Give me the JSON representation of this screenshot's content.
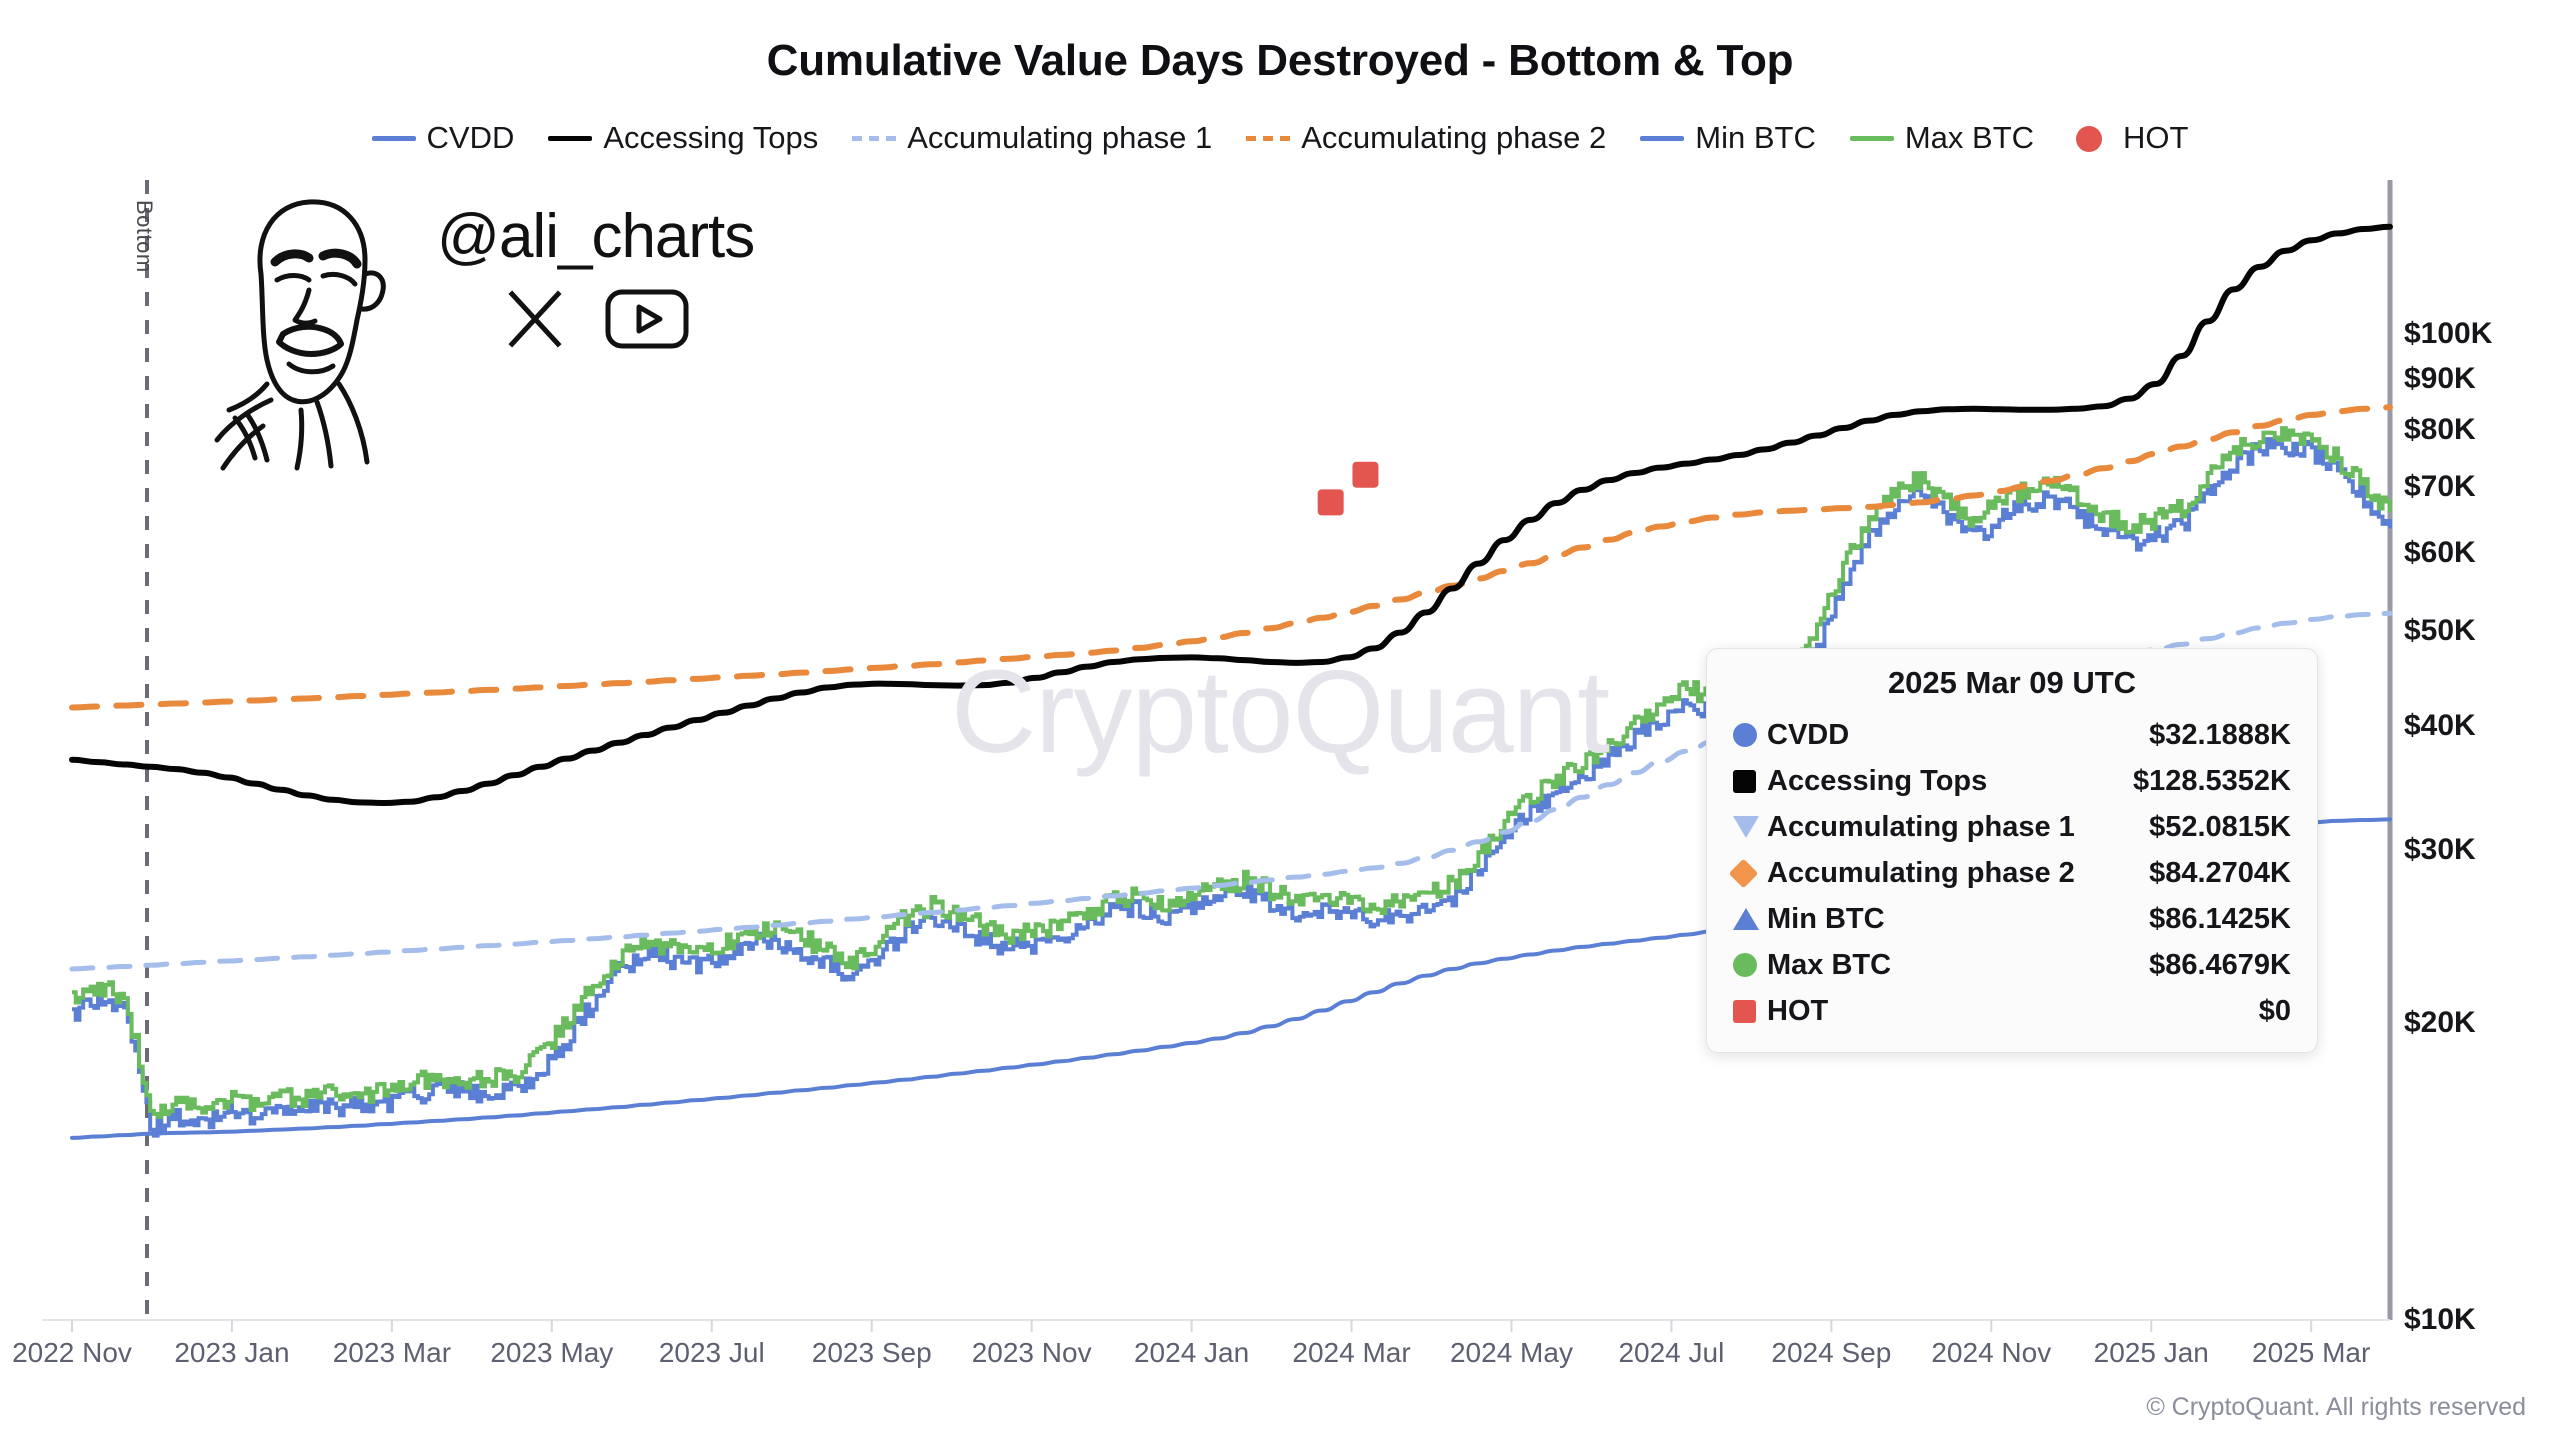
{
  "title": "Cumulative Value Days Destroyed - Bottom & Top",
  "footer": "© CryptoQuant. All rights reserved",
  "watermark_center": "CryptoQuant",
  "branding": {
    "handle": "@ali_charts",
    "x_icon": "x-logo-icon",
    "youtube_icon": "youtube-icon",
    "face_icon": "line-art-face-icon"
  },
  "annotations": [
    {
      "label": "Bottom",
      "x_value": "2022 Dec"
    }
  ],
  "legend": [
    {
      "label": "CVDD",
      "color": "#5b7fd4",
      "style": "line"
    },
    {
      "label": "Accessing Tops",
      "color": "#050505",
      "style": "line"
    },
    {
      "label": "Accumulating phase 1",
      "color": "#a5bdea",
      "style": "dashed"
    },
    {
      "label": "Accumulating phase 2",
      "color": "#e8893c",
      "style": "dashed"
    },
    {
      "label": "Min BTC",
      "color": "#5b7fd4",
      "style": "line"
    },
    {
      "label": "Max BTC",
      "color": "#6aba5e",
      "style": "line"
    },
    {
      "label": "HOT",
      "color": "#e2564f",
      "style": "dot"
    }
  ],
  "tooltip": {
    "title": "2025 Mar 09 UTC",
    "rows": [
      {
        "marker": "circle",
        "color": "#5b7fd4",
        "name": "CVDD",
        "value": "$32.1888K"
      },
      {
        "marker": "square",
        "color": "#050505",
        "name": "Accessing Tops",
        "value": "$128.5352K"
      },
      {
        "marker": "tri-down",
        "color": "#a5bdea",
        "name": "Accumulating phase 1",
        "value": "$52.0815K"
      },
      {
        "marker": "diamond",
        "color": "#f0954b",
        "name": "Accumulating phase 2",
        "value": "$84.2704K"
      },
      {
        "marker": "tri-up",
        "color": "#5b7fd4",
        "name": "Min BTC",
        "value": "$86.1425K"
      },
      {
        "marker": "circle",
        "color": "#6aba5e",
        "name": "Max BTC",
        "value": "$86.4679K"
      },
      {
        "marker": "square",
        "color": "#e2564f",
        "name": "HOT",
        "value": "$0"
      }
    ]
  },
  "chart_data": {
    "type": "line",
    "title": "Cumulative Value Days Destroyed - Bottom & Top",
    "xlabel": "",
    "ylabel": "",
    "yscale": "log",
    "ylim": [
      10000,
      140000
    ],
    "grid": false,
    "legend_position": "top",
    "y_ticks": [
      {
        "label": "$10K",
        "value": 10000
      },
      {
        "label": "$20K",
        "value": 20000
      },
      {
        "label": "$30K",
        "value": 30000
      },
      {
        "label": "$40K",
        "value": 40000
      },
      {
        "label": "$50K",
        "value": 50000
      },
      {
        "label": "$60K",
        "value": 60000
      },
      {
        "label": "$70K",
        "value": 70000
      },
      {
        "label": "$80K",
        "value": 80000
      },
      {
        "label": "$90K",
        "value": 90000
      },
      {
        "label": "$100K",
        "value": 100000
      }
    ],
    "x_ticks": [
      {
        "label": "2022 Nov",
        "t": 0.0
      },
      {
        "label": "2023 Jan",
        "t": 0.069
      },
      {
        "label": "2023 Mar",
        "t": 0.138
      },
      {
        "label": "2023 May",
        "t": 0.207
      },
      {
        "label": "2023 Jul",
        "t": 0.276
      },
      {
        "label": "2023 Sep",
        "t": 0.345
      },
      {
        "label": "2023 Nov",
        "t": 0.414
      },
      {
        "label": "2024 Jan",
        "t": 0.483
      },
      {
        "label": "2024 Mar",
        "t": 0.552
      },
      {
        "label": "2024 May",
        "t": 0.621
      },
      {
        "label": "2024 Jul",
        "t": 0.69
      },
      {
        "label": "2024 Sep",
        "t": 0.759
      },
      {
        "label": "2024 Nov",
        "t": 0.828
      },
      {
        "label": "2025 Jan",
        "t": 0.897
      },
      {
        "label": "2025 Mar",
        "t": 0.966
      }
    ],
    "series": [
      {
        "name": "CVDD",
        "color": "#5b7fd4",
        "style": "line",
        "width": 4,
        "values": [
          15300,
          15350,
          15400,
          15450,
          15480,
          15500,
          15520,
          15560,
          15600,
          15640,
          15690,
          15740,
          15800,
          15860,
          15920,
          15980,
          16050,
          16120,
          16200,
          16280,
          16360,
          16440,
          16530,
          16620,
          16710,
          16800,
          16900,
          17000,
          17100,
          17200,
          17310,
          17420,
          17530,
          17650,
          17780,
          17900,
          18030,
          18160,
          18300,
          18450,
          18600,
          18760,
          18930,
          19100,
          19300,
          19550,
          19850,
          20200,
          20600,
          21050,
          21500,
          21950,
          22350,
          22700,
          23000,
          23250,
          23480,
          23700,
          23900,
          24080,
          24250,
          24420,
          24600,
          24800,
          25050,
          25350,
          25700,
          26100,
          26550,
          27000,
          27450,
          27850,
          28200,
          28500,
          28780,
          29050,
          29330,
          29620,
          29920,
          30230,
          30540,
          30850,
          31150,
          31420,
          31650,
          31830,
          31970,
          32080,
          32150,
          32190
        ]
      },
      {
        "name": "Accessing Tops",
        "color": "#050505",
        "style": "line",
        "width": 6,
        "values": [
          37000,
          36800,
          36600,
          36400,
          36200,
          35900,
          35500,
          35000,
          34500,
          34050,
          33700,
          33500,
          33450,
          33550,
          33900,
          34400,
          35000,
          35700,
          36400,
          37100,
          37800,
          38500,
          39200,
          39900,
          40600,
          41300,
          42000,
          42700,
          43300,
          43800,
          44100,
          44200,
          44150,
          44050,
          44000,
          44050,
          44300,
          44800,
          45400,
          46000,
          46500,
          46800,
          46950,
          47000,
          46900,
          46700,
          46500,
          46400,
          46500,
          47000,
          48000,
          49800,
          52200,
          55200,
          58500,
          61800,
          64800,
          67400,
          69500,
          71100,
          72300,
          73200,
          73900,
          74600,
          75400,
          76400,
          77600,
          78900,
          80300,
          81700,
          82800,
          83500,
          83900,
          84000,
          83900,
          83800,
          83800,
          84000,
          84500,
          86000,
          89000,
          95000,
          103000,
          111000,
          117000,
          121500,
          124500,
          126500,
          127800,
          128500
        ]
      },
      {
        "name": "Accumulating phase 1",
        "color": "#a5bdea",
        "style": "dashed",
        "width": 5,
        "values": [
          22700,
          22760,
          22830,
          22900,
          22980,
          23050,
          23130,
          23200,
          23280,
          23360,
          23440,
          23520,
          23610,
          23700,
          23790,
          23880,
          23970,
          24060,
          24160,
          24260,
          24360,
          24460,
          24570,
          24680,
          24790,
          24900,
          25020,
          25140,
          25260,
          25380,
          25510,
          25640,
          25770,
          25900,
          26040,
          26180,
          26320,
          26470,
          26620,
          26770,
          26930,
          27090,
          27250,
          27420,
          27590,
          27770,
          27950,
          28130,
          28320,
          28520,
          28750,
          29050,
          29450,
          29950,
          30550,
          31250,
          32050,
          32950,
          33900,
          34900,
          35900,
          36850,
          37750,
          38600,
          39400,
          40150,
          40850,
          41500,
          42100,
          42650,
          43150,
          43600,
          44050,
          44500,
          44950,
          45400,
          45850,
          46300,
          46800,
          47300,
          47850,
          48450,
          49100,
          49750,
          50350,
          50900,
          51350,
          51700,
          51950,
          52080
        ]
      },
      {
        "name": "Accumulating phase 2",
        "color": "#e8893c",
        "style": "dashed",
        "width": 6,
        "values": [
          41800,
          41900,
          42000,
          42100,
          42200,
          42300,
          42400,
          42500,
          42600,
          42700,
          42820,
          42940,
          43060,
          43180,
          43300,
          43430,
          43560,
          43690,
          43820,
          43960,
          44100,
          44250,
          44400,
          44550,
          44700,
          44860,
          45020,
          45180,
          45350,
          45520,
          45700,
          45880,
          46060,
          46250,
          46450,
          46650,
          46850,
          47060,
          47280,
          47500,
          47750,
          48050,
          48400,
          48800,
          49250,
          49750,
          50300,
          50900,
          51550,
          52250,
          53000,
          53800,
          54650,
          55550,
          56500,
          57500,
          58550,
          59650,
          60750,
          61850,
          62900,
          63800,
          64550,
          65150,
          65600,
          65950,
          66200,
          66400,
          66600,
          66800,
          67100,
          67500,
          68000,
          68600,
          69300,
          70100,
          71000,
          72000,
          73100,
          74300,
          75600,
          76900,
          78200,
          79500,
          80700,
          81800,
          82800,
          83500,
          84000,
          84270
        ]
      },
      {
        "name": "Min BTC",
        "color": "#5b7fd4",
        "style": "step",
        "width": 4,
        "values": [
          20500,
          21300,
          20600,
          15600,
          16100,
          15900,
          16250,
          16150,
          16300,
          16400,
          16500,
          16400,
          16600,
          16900,
          17100,
          17050,
          16950,
          17200,
          17800,
          19100,
          21000,
          22700,
          23500,
          23200,
          22900,
          23400,
          24300,
          24100,
          23700,
          23100,
          22100,
          23200,
          24900,
          25600,
          25200,
          24300,
          23800,
          24100,
          24600,
          25300,
          26100,
          26200,
          25700,
          26400,
          27000,
          27100,
          26500,
          25900,
          26000,
          25800,
          25400,
          25700,
          26100,
          26800,
          28700,
          30800,
          32900,
          34200,
          35500,
          37100,
          38900,
          40800,
          42300,
          41200,
          39700,
          40900,
          43200,
          48000,
          56000,
          62000,
          67000,
          69000,
          65000,
          62000,
          65000,
          67000,
          68000,
          66000,
          63000,
          61500,
          62500,
          64000,
          69000,
          74000,
          76500,
          77000,
          76000,
          72000,
          68000,
          63500
        ]
      },
      {
        "name": "Max BTC",
        "color": "#6aba5e",
        "style": "step",
        "width": 4,
        "values": [
          21300,
          21900,
          21200,
          16300,
          16500,
          16400,
          16700,
          16600,
          16750,
          16850,
          16950,
          16900,
          17100,
          17400,
          17600,
          17550,
          17500,
          17800,
          18600,
          20100,
          21900,
          23400,
          24100,
          23900,
          23500,
          24000,
          25000,
          24800,
          24400,
          23800,
          23100,
          24100,
          25700,
          26300,
          25900,
          25100,
          24500,
          24800,
          25300,
          26000,
          26800,
          26900,
          26500,
          27100,
          27700,
          27900,
          27300,
          26700,
          26800,
          26600,
          26300,
          26500,
          26900,
          27700,
          29700,
          31900,
          34100,
          35400,
          36700,
          38400,
          40300,
          42200,
          43800,
          42700,
          41200,
          42400,
          44800,
          49800,
          58000,
          64500,
          69500,
          71500,
          67500,
          64500,
          67500,
          69500,
          70500,
          68500,
          65500,
          64000,
          65000,
          66500,
          71500,
          76500,
          79000,
          79500,
          78500,
          74500,
          70500,
          66000
        ]
      }
    ],
    "hot_markers": [
      {
        "t": 0.543,
        "value": 67500
      },
      {
        "t": 0.558,
        "value": 72000
      }
    ]
  }
}
